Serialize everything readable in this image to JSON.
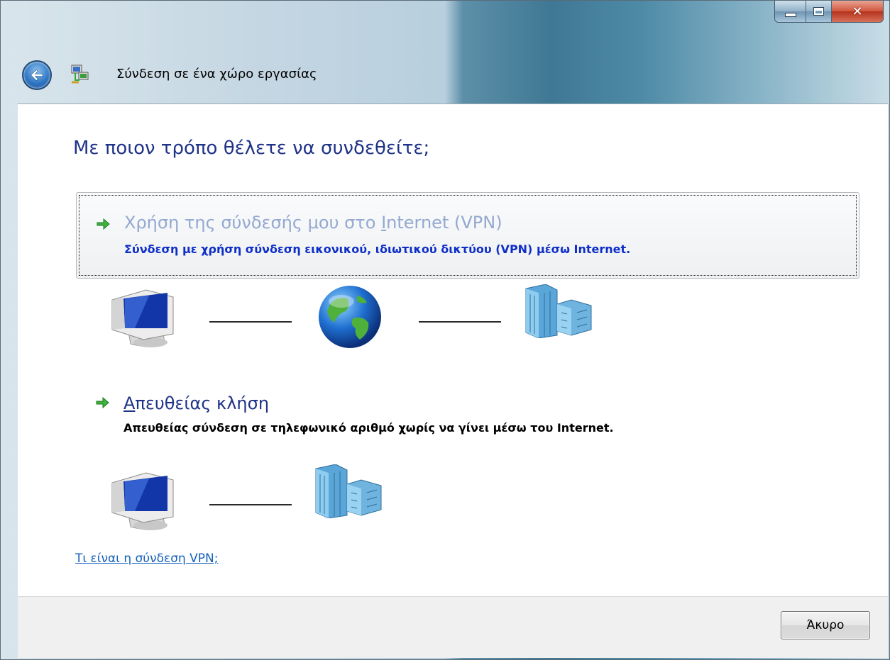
{
  "window": {
    "title": "Σύνδεση σε ένα χώρο εργασίας",
    "minimize_icon": "minimize-icon",
    "maximize_icon": "maximize-icon",
    "close_icon": "close-icon",
    "back_icon": "back-arrow-icon"
  },
  "main": {
    "heading": "Με ποιον τρόπο θέλετε να συνδεθείτε;",
    "options": [
      {
        "title_pre": "Χρήση της σύνδεσής μου στο ",
        "title_accel": "I",
        "title_post": "nternet (VPN)",
        "description": "Σύνδεση με χρήση σύνδεση εικονικού, ιδιωτικού δικτύου (VPN) μέσω Internet.",
        "diagram": [
          "computer-icon",
          "globe-icon",
          "office-building-icon"
        ]
      },
      {
        "title_accel": "Α",
        "title_post": "πευθείας κλήση",
        "description": "Απευθείας σύνδεση σε τηλεφωνικό αριθμό χωρίς να γίνει μέσω του Internet.",
        "diagram": [
          "computer-icon",
          "office-building-icon"
        ]
      }
    ],
    "help_link": "Τι είναι η σύνδεση VPN;"
  },
  "footer": {
    "cancel_label": "Άκυρο"
  },
  "colors": {
    "heading": "#1e3287",
    "option1_title": "#94a8cf",
    "option1_desc": "#0e2ec8",
    "link": "#1561ba"
  }
}
